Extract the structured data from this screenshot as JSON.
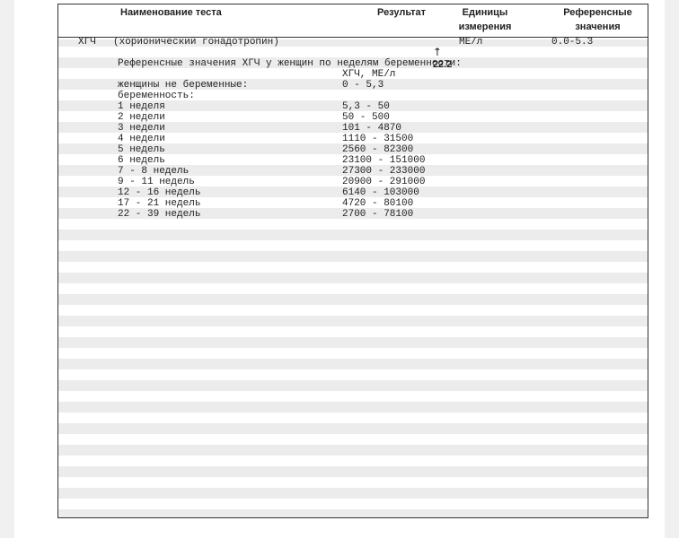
{
  "header": {
    "test_name": "Наименование теста",
    "result": "Результат",
    "units_line1": "Единицы",
    "units_line2": "измерения",
    "ref_line1": "Референсные",
    "ref_line2": "значения"
  },
  "test": {
    "code": "ХГЧ",
    "name": "(хорионический гонадотропин)",
    "arrow": "↑",
    "result": "22.2",
    "units": "МЕ/л",
    "reference": "0.0-5.3"
  },
  "ref_table": {
    "intro": "Референсные значения ХГЧ у женщин по неделям беременности:",
    "unit_header": "ХГЧ, МЕ/л",
    "rows": [
      {
        "label": "женщины не беременные:",
        "value": "0 - 5,3"
      },
      {
        "label": "беременность:",
        "value": ""
      },
      {
        "label": "1 неделя",
        "value": "5,3 - 50"
      },
      {
        "label": "2 недели",
        "value": "50 - 500"
      },
      {
        "label": "3 недели",
        "value": "101 - 4870"
      },
      {
        "label": "4 недели",
        "value": "1110 - 31500"
      },
      {
        "label": "5 недель",
        "value": "2560 - 82300"
      },
      {
        "label": "6 недель",
        "value": "23100 - 151000"
      },
      {
        "label": "7 - 8 недель",
        "value": "27300 - 233000"
      },
      {
        "label": "9 - 11 недель",
        "value": "20900 - 291000"
      },
      {
        "label": "12 - 16 недель",
        "value": "6140 - 103000"
      },
      {
        "label": "17 - 21 недель",
        "value": "4720 - 80100"
      },
      {
        "label": "22 - 39 недель",
        "value": "2700 - 78100"
      }
    ]
  }
}
